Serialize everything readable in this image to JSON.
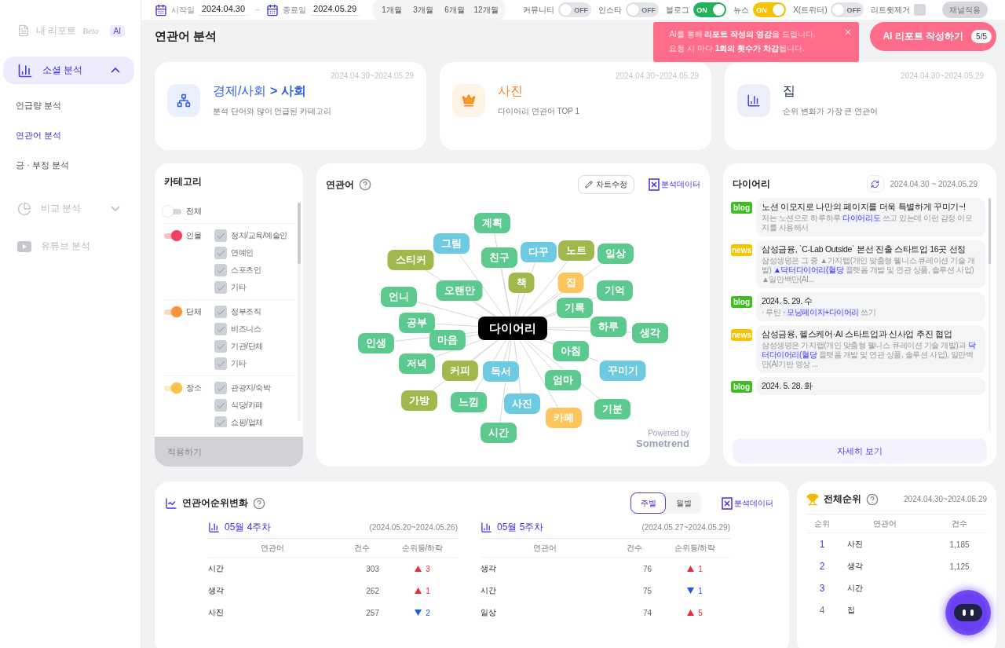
{
  "sidebar": {
    "header": {
      "title": "내 리포트",
      "tag": "Beta",
      "badge": "AI"
    },
    "items": [
      {
        "kind": "folder-chart",
        "label": "소셜 분석",
        "selected": true,
        "expanded": true,
        "disabled": false,
        "children": [
          {
            "label": "언급량 분석",
            "selected": false
          },
          {
            "label": "연관어 분석",
            "selected": true
          },
          {
            "label": "긍 · 부정 분석",
            "selected": false
          }
        ]
      },
      {
        "kind": "pie",
        "label": "비교 분석",
        "selected": false,
        "expanded": false,
        "disabled": true
      },
      {
        "kind": "play",
        "label": "유튜브 분석",
        "selected": false,
        "disabled": true
      }
    ]
  },
  "toolbar": {
    "start_label": "시작일",
    "start": "2024.04.30",
    "end_label": "종료일",
    "end": "2024.05.29",
    "ranges": [
      {
        "label": "1개월",
        "selected": false
      },
      {
        "label": "3개월",
        "selected": false
      },
      {
        "label": "6개월",
        "selected": false
      },
      {
        "label": "12개월",
        "selected": false
      }
    ],
    "channels": [
      {
        "label": "커뮤니티",
        "on": false,
        "switch_text": "OFF"
      },
      {
        "label": "인스타",
        "on": false,
        "switch_text": "OFF"
      },
      {
        "label": "블로그",
        "on": true,
        "switch_text": "ON",
        "color": "#22b35a"
      },
      {
        "label": "뉴스",
        "on": true,
        "switch_text": "ON",
        "color": "#f7c300"
      },
      {
        "label": "X(트위터)",
        "on": false,
        "switch_text": "OFF"
      }
    ],
    "retweet": {
      "label": "리트윗제거",
      "checked": false
    },
    "apply": {
      "label": "채널적용",
      "disabled": true
    }
  },
  "page": {
    "title": "연관어 분석"
  },
  "ai_tip": {
    "lines": [
      "AI를 통해 **리포트 작성의 영감**을 드립니다.",
      "요청 시 마다 **1회의 횟수가 차감**됩니다."
    ]
  },
  "ai_button": {
    "label": "AI 리포트 작성하기",
    "quota": "5/5"
  },
  "summary_cards": [
    {
      "kind": "category",
      "date": "2024.04.30~2024.05.29",
      "title": "경제/사회 **> 사회**",
      "subtitle": "분석 단어와 많이 언급된 카테고리",
      "color": "#2f5fe3"
    },
    {
      "kind": "top",
      "date": "2024.04.30~2024.05.29",
      "title": "사진",
      "subtitle": "다이어리 연관어 TOP 1",
      "color": "#f5871f"
    },
    {
      "kind": "change",
      "date": "2024.04.30~2024.05.29",
      "title": "집",
      "subtitle": "순위 변화가 가장 큰 연관어",
      "color": "#1d2752"
    }
  ],
  "category": {
    "title": "카테고리",
    "apply": "적용하기",
    "groups": [
      {
        "label": "전체",
        "on": false
      },
      {
        "label": "인물",
        "on": true,
        "color": "#f2415f",
        "items": [
          {
            "label": "정치/교육/예술인",
            "checked": true
          },
          {
            "label": "연예인",
            "checked": true
          },
          {
            "label": "스포츠인",
            "checked": true
          },
          {
            "label": "기타",
            "checked": true
          }
        ]
      },
      {
        "label": "단체",
        "on": true,
        "color": "#f7923a",
        "items": [
          {
            "label": "정부조직",
            "checked": true
          },
          {
            "label": "비즈니스",
            "checked": true
          },
          {
            "label": "기관/단체",
            "checked": true
          },
          {
            "label": "기타",
            "checked": true
          }
        ]
      },
      {
        "label": "장소",
        "on": true,
        "color": "#fcc245",
        "items": [
          {
            "label": "관광지/숙박",
            "checked": true
          },
          {
            "label": "식당/카페",
            "checked": true
          },
          {
            "label": "쇼핑/업체",
            "checked": true
          }
        ]
      }
    ]
  },
  "graph": {
    "title": "연관어",
    "edit_button": "차트수정",
    "data_button": "분석데이터",
    "center": "다이어리",
    "powered_by": "Powered by",
    "brand": "Sometrend",
    "nodes": [
      {
        "label": "계획",
        "color": "#5cc98f"
      },
      {
        "label": "그림",
        "color": "#6ccbe0"
      },
      {
        "label": "스티커",
        "color": "#a1b94c"
      },
      {
        "label": "친구",
        "color": "#5cc98f"
      },
      {
        "label": "다꾸",
        "color": "#6ccbe0"
      },
      {
        "label": "노트",
        "color": "#a1b94c"
      },
      {
        "label": "일상",
        "color": "#5cc98f"
      },
      {
        "label": "책",
        "color": "#a1b94c"
      },
      {
        "label": "집",
        "color": "#fdc55c"
      },
      {
        "label": "오랜만",
        "color": "#5cc98f"
      },
      {
        "label": "언니",
        "color": "#5cc98f"
      },
      {
        "label": "기억",
        "color": "#5cc98f"
      },
      {
        "label": "기록",
        "color": "#5cc98f"
      },
      {
        "label": "공부",
        "color": "#5cc98f"
      },
      {
        "label": "하루",
        "color": "#5cc98f"
      },
      {
        "label": "생각",
        "color": "#5cc98f"
      },
      {
        "label": "마음",
        "color": "#5cc98f"
      },
      {
        "label": "인생",
        "color": "#5cc98f"
      },
      {
        "label": "아침",
        "color": "#5cc98f"
      },
      {
        "label": "저녁",
        "color": "#5cc98f"
      },
      {
        "label": "커피",
        "color": "#a1b94c"
      },
      {
        "label": "독서",
        "color": "#6ccbe0"
      },
      {
        "label": "꾸미기",
        "color": "#6ccbe0"
      },
      {
        "label": "엄마",
        "color": "#5cc98f"
      },
      {
        "label": "가방",
        "color": "#a1b94c"
      },
      {
        "label": "느낌",
        "color": "#5cc98f"
      },
      {
        "label": "사진",
        "color": "#6ccbe0"
      },
      {
        "label": "기분",
        "color": "#5cc98f"
      },
      {
        "label": "카페",
        "color": "#fdc55c"
      },
      {
        "label": "시간",
        "color": "#5cc98f"
      }
    ]
  },
  "diary": {
    "title": "다이어리",
    "date_range": "2024.04.30 ~ 2024.05.29",
    "more": "자세히 보기",
    "items": [
      {
        "kind": "blog",
        "source": "blog",
        "title": "노션 이모지로 나만의 페이지를 더욱 특별하게 꾸미기~!",
        "snippet": "저는 노션으로 하루하루 **다이어리도** 쓰고 있는데 이런 감정 이모지를 사용해서"
      },
      {
        "kind": "news",
        "source": "news",
        "title": "삼성금융, `C-Lab Outside` 본선 진출 스타트업 16곳 선정",
        "snippet": "삼성생명은 그 중 ▲가지랩(개인 맞춤형 웰니스 큐레이션 기술 개발) **▲닥터다이어리(혈당** 플랫폼 개발 및 연관 상품, 솔루션 사업) ▲일만백만(AI..."
      },
      {
        "kind": "blog",
        "source": "blog",
        "title": "2024. 5. 29. 수",
        "snippet": "· 루틴 **· 모닝페이지+다이어리** 쓰기"
      },
      {
        "kind": "news",
        "source": "news",
        "title": "삼성금융, 헬스케어·AI 스타트업과 신사업 추진 협업",
        "snippet": "삼성생명은 가지랩(개인 맞춤형 웰니스 큐레이션 기술 개발)과 **닥터다이어리(혈당** 플랫폼 개발 및 연관 상품, 솔루션 사업), 일만백만(AI기반 영상 ..."
      },
      {
        "kind": "blog",
        "source": "blog",
        "title": "2024. 5. 28. 화"
      }
    ]
  },
  "rank_change": {
    "title": "연관어순위변화",
    "data_button": "분석데이터",
    "views": [
      {
        "label": "주별",
        "selected": true
      },
      {
        "label": "월별",
        "selected": false
      }
    ],
    "weeks": [
      {
        "title": "05월 4주차",
        "range": "(2024.05.20~2024.05.26)",
        "columns": [
          "연관어",
          "건수",
          "순위등/하락"
        ],
        "rows": [
          {
            "word": "시간",
            "count": "303",
            "rising": true,
            "change": "3"
          },
          {
            "word": "생각",
            "count": "262",
            "rising": true,
            "change": "1"
          },
          {
            "word": "사진",
            "count": "257",
            "rising": false,
            "change": "2"
          }
        ]
      },
      {
        "title": "05월 5주차",
        "range": "(2024.05.27~2024.05.29)",
        "columns": [
          "연관어",
          "건수",
          "순위등/하락"
        ],
        "rows": [
          {
            "word": "생각",
            "count": "76",
            "rising": true,
            "change": "1"
          },
          {
            "word": "시간",
            "count": "75",
            "rising": false,
            "change": "1"
          },
          {
            "word": "일상",
            "count": "74",
            "rising": true,
            "change": "5"
          }
        ]
      }
    ]
  },
  "total_rank": {
    "title": "전체순위",
    "date_range": "2024.04.30~2024.05.29",
    "columns": [
      "순위",
      "연관어",
      "건수"
    ],
    "rows": [
      {
        "rank": "1",
        "word": "사진",
        "count": "1,185",
        "top": true
      },
      {
        "rank": "2",
        "word": "생각",
        "count": "1,125",
        "top": true
      },
      {
        "rank": "3",
        "word": "시간",
        "top": true
      },
      {
        "rank": "4",
        "word": "집",
        "top": false
      }
    ]
  }
}
